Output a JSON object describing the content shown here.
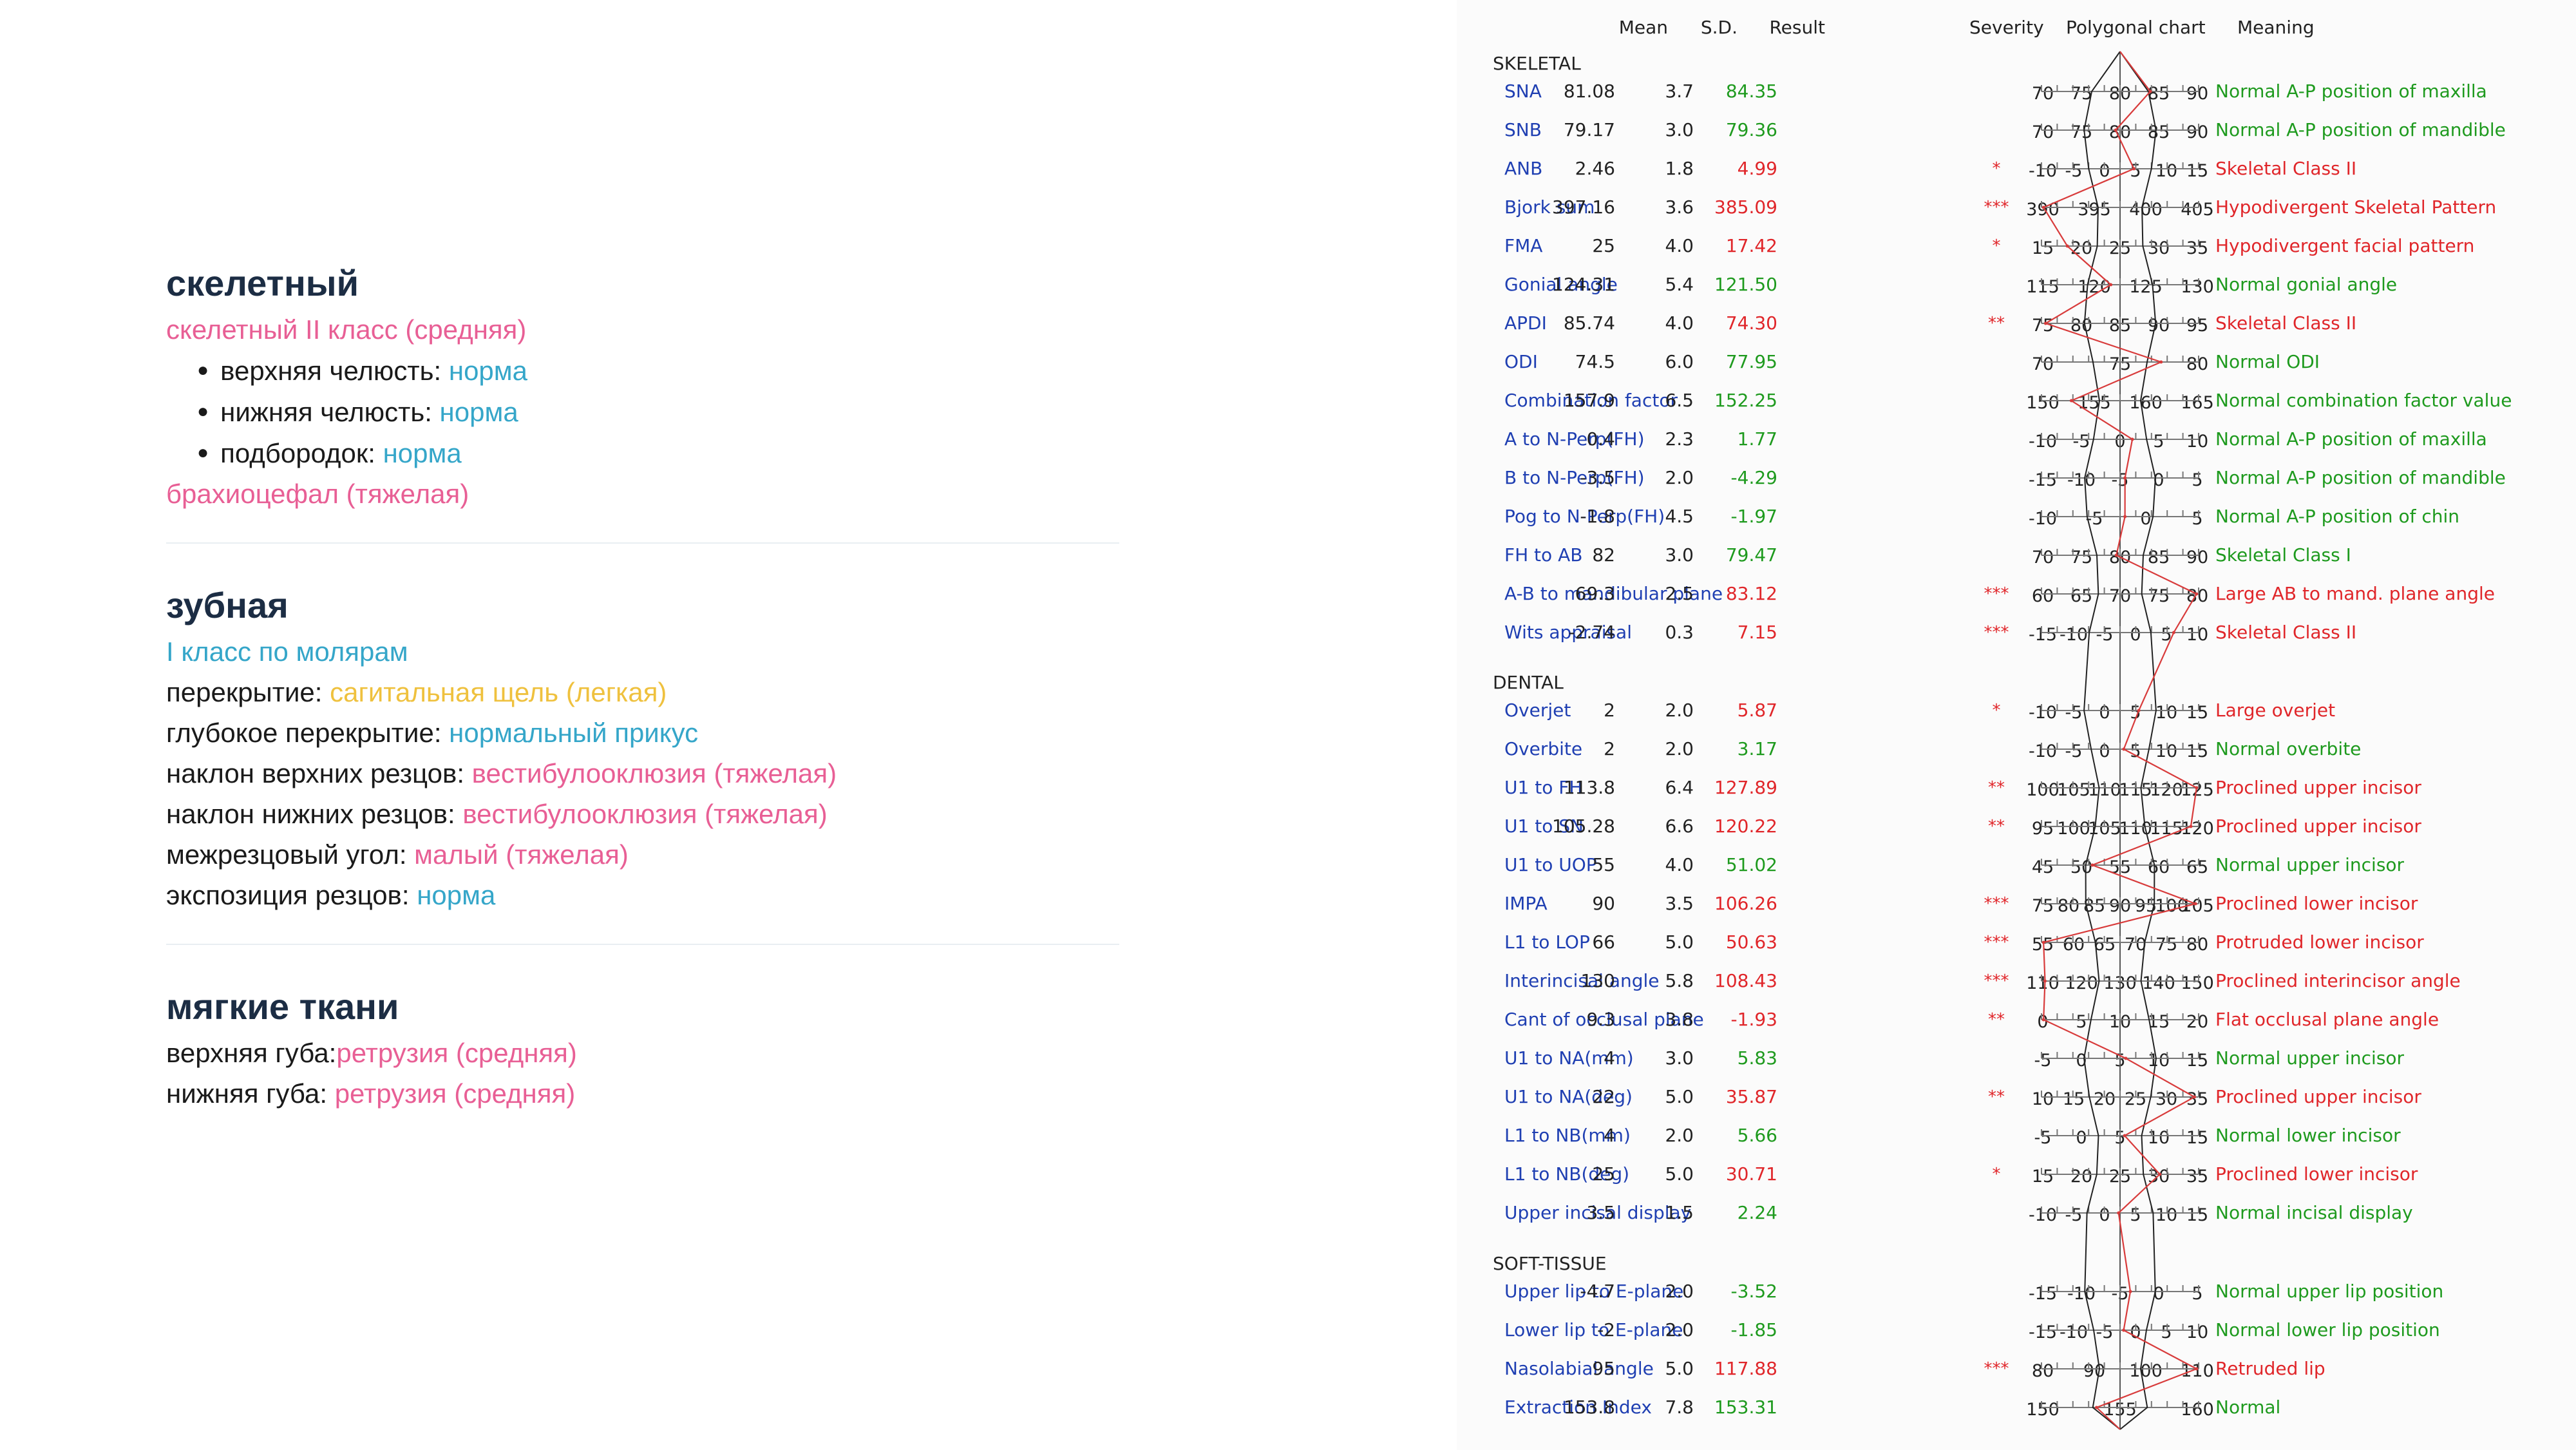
{
  "summary": {
    "skeletal": {
      "title": "скелетный",
      "class": "скелетный II класс (средняя)",
      "items": [
        {
          "label": "верхняя челюсть: ",
          "value": "норма"
        },
        {
          "label": "нижняя челюсть: ",
          "value": "норма"
        },
        {
          "label": "подбородок: ",
          "value": "норма"
        }
      ],
      "face": "брахиоцефал (тяжелая)"
    },
    "dental": {
      "title": "зубная",
      "class": "I класс по молярам",
      "items": [
        {
          "label": "перекрытие: ",
          "value": "сагитальная щель (легкая)",
          "color": "#efc13e"
        },
        {
          "label": "глубокое перекрытие: ",
          "value": "нормальный прикус",
          "color": "#35a6c9"
        },
        {
          "label": "наклон верхних резцов: ",
          "value": "вестибулооклюзия (тяжелая)",
          "color": "#e85f95"
        },
        {
          "label": "наклон нижних резцов: ",
          "value": "вестибулооклюзия (тяжелая)",
          "color": "#e85f95"
        },
        {
          "label": "межрезцовый угол: ",
          "value": "малый  (тяжелая)",
          "color": "#e85f95"
        },
        {
          "label": "экспозиция резцов: ",
          "value": "норма",
          "color": "#35a6c9"
        }
      ]
    },
    "soft": {
      "title": "мягкие ткани",
      "items": [
        {
          "label": "верхняя губа:",
          "value": "ретрузия  (средняя)",
          "color": "#e85f95"
        },
        {
          "label": "нижняя губа: ",
          "value": "ретрузия  (средняя)",
          "color": "#e85f95"
        }
      ]
    }
  },
  "report": {
    "headers": {
      "mean": "Mean",
      "sd": "S.D.",
      "result": "Result",
      "severity": "Severity",
      "chart": "Polygonal chart",
      "meaning": "Meaning"
    },
    "colors": {
      "normal": "#1e9a1e",
      "abnormal": "#e0262a",
      "name": "#1f3fb2"
    },
    "groups": [
      {
        "title": "SKELETAL",
        "rows": [
          {
            "name": "SNA",
            "mean": "81.08",
            "sd": "3.7",
            "result": "84.35",
            "severity": "",
            "ticks": [
              "70",
              "75",
              "80",
              "85",
              "90"
            ],
            "meaning": "Normal A-P position of maxilla",
            "abnormal": false
          },
          {
            "name": "SNB",
            "mean": "79.17",
            "sd": "3.0",
            "result": "79.36",
            "severity": "",
            "ticks": [
              "70",
              "75",
              "80",
              "85",
              "90"
            ],
            "meaning": "Normal A-P position of mandible",
            "abnormal": false
          },
          {
            "name": "ANB",
            "mean": "2.46",
            "sd": "1.8",
            "result": "4.99",
            "severity": "*",
            "ticks": [
              "-10",
              "-5",
              "0",
              "5",
              "10",
              "15"
            ],
            "meaning": "Skeletal Class II",
            "abnormal": true
          },
          {
            "name": "Bjork sum",
            "mean": "397.16",
            "sd": "3.6",
            "result": "385.09",
            "severity": "***",
            "ticks": [
              "390",
              "395",
              "400",
              "405"
            ],
            "meaning": "Hypodivergent Skeletal Pattern",
            "abnormal": true
          },
          {
            "name": "FMA",
            "mean": "25",
            "sd": "4.0",
            "result": "17.42",
            "severity": "*",
            "ticks": [
              "15",
              "20",
              "25",
              "30",
              "35"
            ],
            "meaning": "Hypodivergent facial pattern",
            "abnormal": true
          },
          {
            "name": "Gonial angle",
            "mean": "124.31",
            "sd": "5.4",
            "result": "121.50",
            "severity": "",
            "ticks": [
              "115",
              "120",
              "125",
              "130"
            ],
            "meaning": "Normal gonial angle",
            "abnormal": false
          },
          {
            "name": "APDI",
            "mean": "85.74",
            "sd": "4.0",
            "result": "74.30",
            "severity": "**",
            "ticks": [
              "75",
              "80",
              "85",
              "90",
              "95"
            ],
            "meaning": "Skeletal Class II",
            "abnormal": true
          },
          {
            "name": "ODI",
            "mean": "74.5",
            "sd": "6.0",
            "result": "77.95",
            "severity": "",
            "ticks": [
              "70",
              "75",
              "80"
            ],
            "meaning": "Normal ODI",
            "abnormal": false
          },
          {
            "name": "Combination factor",
            "mean": "157.9",
            "sd": "6.5",
            "result": "152.25",
            "severity": "",
            "ticks": [
              "150",
              "155",
              "160",
              "165"
            ],
            "meaning": "Normal combination factor value",
            "abnormal": false
          },
          {
            "name": "A to N-Perp(FH)",
            "mean": "0.4",
            "sd": "2.3",
            "result": "1.77",
            "severity": "",
            "ticks": [
              "-10",
              "-5",
              "0",
              "5",
              "10"
            ],
            "meaning": "Normal A-P position of maxilla",
            "abnormal": false
          },
          {
            "name": "B to N-Perp(FH)",
            "mean": "-3.5",
            "sd": "2.0",
            "result": "-4.29",
            "severity": "",
            "ticks": [
              "-15",
              "-10",
              "-5",
              "0",
              "5"
            ],
            "meaning": "Normal A-P position of mandible",
            "abnormal": false
          },
          {
            "name": "Pog to N-Perp(FH)",
            "mean": "-1.8",
            "sd": "4.5",
            "result": "-1.97",
            "severity": "",
            "ticks": [
              "-10",
              "-5",
              "0",
              "5"
            ],
            "meaning": "Normal A-P position of chin",
            "abnormal": false
          },
          {
            "name": "FH to AB",
            "mean": "82",
            "sd": "3.0",
            "result": "79.47",
            "severity": "",
            "ticks": [
              "70",
              "75",
              "80",
              "85",
              "90"
            ],
            "meaning": "Skeletal Class I",
            "abnormal": false
          },
          {
            "name": "A-B to mandibular plane",
            "mean": "69.3",
            "sd": "2.5",
            "result": "83.12",
            "severity": "***",
            "ticks": [
              "60",
              "65",
              "70",
              "75",
              "80"
            ],
            "meaning": "Large AB to mand. plane angle",
            "abnormal": true
          },
          {
            "name": "Wits appraisal",
            "mean": "-2.74",
            "sd": "0.3",
            "result": "7.15",
            "severity": "***",
            "ticks": [
              "-15",
              "-10",
              "-5",
              "0",
              "5",
              "10"
            ],
            "meaning": "Skeletal Class II",
            "abnormal": true
          }
        ]
      },
      {
        "title": "DENTAL",
        "rows": [
          {
            "name": "Overjet",
            "mean": "2",
            "sd": "2.0",
            "result": "5.87",
            "severity": "*",
            "ticks": [
              "-10",
              "-5",
              "0",
              "5",
              "10",
              "15"
            ],
            "meaning": "Large overjet",
            "abnormal": true
          },
          {
            "name": "Overbite",
            "mean": "2",
            "sd": "2.0",
            "result": "3.17",
            "severity": "",
            "ticks": [
              "-10",
              "-5",
              "0",
              "5",
              "10",
              "15"
            ],
            "meaning": "Normal overbite",
            "abnormal": false
          },
          {
            "name": "U1 to FH",
            "mean": "113.8",
            "sd": "6.4",
            "result": "127.89",
            "severity": "**",
            "ticks": [
              "100",
              "105",
              "110",
              "115",
              "120",
              "125"
            ],
            "meaning": "Proclined upper incisor",
            "abnormal": true
          },
          {
            "name": "U1 to SN",
            "mean": "105.28",
            "sd": "6.6",
            "result": "120.22",
            "severity": "**",
            "ticks": [
              "95",
              "100",
              "105",
              "110",
              "115",
              "120"
            ],
            "meaning": "Proclined upper incisor",
            "abnormal": true
          },
          {
            "name": "U1 to UOP",
            "mean": "55",
            "sd": "4.0",
            "result": "51.02",
            "severity": "",
            "ticks": [
              "45",
              "50",
              "55",
              "60",
              "65"
            ],
            "meaning": "Normal upper incisor",
            "abnormal": false
          },
          {
            "name": "IMPA",
            "mean": "90",
            "sd": "3.5",
            "result": "106.26",
            "severity": "***",
            "ticks": [
              "75",
              "80",
              "85",
              "90",
              "95",
              "100",
              "105"
            ],
            "meaning": "Proclined lower incisor",
            "abnormal": true
          },
          {
            "name": "L1 to LOP",
            "mean": "66",
            "sd": "5.0",
            "result": "50.63",
            "severity": "***",
            "ticks": [
              "55",
              "60",
              "65",
              "70",
              "75",
              "80"
            ],
            "meaning": "Protruded lower incisor",
            "abnormal": true
          },
          {
            "name": "Interincisal angle",
            "mean": "130",
            "sd": "5.8",
            "result": "108.43",
            "severity": "***",
            "ticks": [
              "110",
              "120",
              "130",
              "140",
              "150"
            ],
            "meaning": "Proclined interincisor angle",
            "abnormal": true
          },
          {
            "name": "Cant of occlusal plane",
            "mean": "9.3",
            "sd": "3.8",
            "result": "-1.93",
            "severity": "**",
            "ticks": [
              "0",
              "5",
              "10",
              "15",
              "20"
            ],
            "meaning": "Flat occlusal plane angle",
            "abnormal": true
          },
          {
            "name": "U1 to NA(mm)",
            "mean": "4",
            "sd": "3.0",
            "result": "5.83",
            "severity": "",
            "ticks": [
              "-5",
              "0",
              "5",
              "10",
              "15"
            ],
            "meaning": "Normal upper incisor",
            "abnormal": false
          },
          {
            "name": "U1 to NA(deg)",
            "mean": "22",
            "sd": "5.0",
            "result": "35.87",
            "severity": "**",
            "ticks": [
              "10",
              "15",
              "20",
              "25",
              "30",
              "35"
            ],
            "meaning": "Proclined upper incisor",
            "abnormal": true
          },
          {
            "name": "L1 to NB(mm)",
            "mean": "4",
            "sd": "2.0",
            "result": "5.66",
            "severity": "",
            "ticks": [
              "-5",
              "0",
              "5",
              "10",
              "15"
            ],
            "meaning": "Normal lower incisor",
            "abnormal": false
          },
          {
            "name": "L1 to NB(deg)",
            "mean": "25",
            "sd": "5.0",
            "result": "30.71",
            "severity": "*",
            "ticks": [
              "15",
              "20",
              "25",
              "30",
              "35"
            ],
            "meaning": "Proclined lower incisor",
            "abnormal": true
          },
          {
            "name": "Upper incisal display",
            "mean": "3.5",
            "sd": "1.5",
            "result": "2.24",
            "severity": "",
            "ticks": [
              "-10",
              "-5",
              "0",
              "5",
              "10",
              "15"
            ],
            "meaning": "Normal incisal display",
            "abnormal": false
          }
        ]
      },
      {
        "title": "SOFT-TISSUE",
        "rows": [
          {
            "name": "Upper lip to E-plane",
            "mean": "-4.7",
            "sd": "2.0",
            "result": "-3.52",
            "severity": "",
            "ticks": [
              "-15",
              "-10",
              "-5",
              "0",
              "5"
            ],
            "meaning": "Normal upper lip position",
            "abnormal": false
          },
          {
            "name": "Lower lip to E-plane",
            "mean": "-2",
            "sd": "2.0",
            "result": "-1.85",
            "severity": "",
            "ticks": [
              "-15",
              "-10",
              "-5",
              "0",
              "5",
              "10"
            ],
            "meaning": "Normal lower lip position",
            "abnormal": false
          },
          {
            "name": "Nasolabial angle",
            "mean": "95",
            "sd": "5.0",
            "result": "117.88",
            "severity": "***",
            "ticks": [
              "80",
              "90",
              "100",
              "110"
            ],
            "meaning": "Retruded lip",
            "abnormal": true
          },
          {
            "name": "Extraction Index",
            "mean": "153.8",
            "sd": "7.8",
            "result": "153.31",
            "severity": "",
            "ticks": [
              "150",
              "155",
              "160"
            ],
            "meaning": "Normal",
            "abnormal": false
          }
        ]
      }
    ]
  }
}
